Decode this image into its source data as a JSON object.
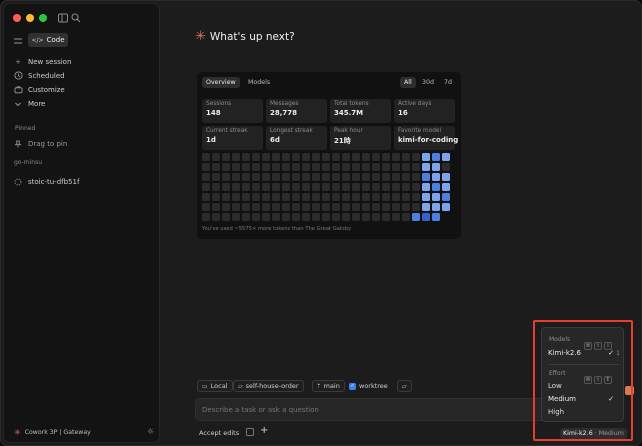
{
  "sidebar": {
    "mode_label": "Code",
    "actions": [
      {
        "label": "New session",
        "icon": "plus-icon"
      },
      {
        "label": "Scheduled",
        "icon": "clock-icon"
      },
      {
        "label": "Customize",
        "icon": "briefcase-icon"
      },
      {
        "label": "More",
        "icon": "chevron-down-icon"
      }
    ],
    "pinned_heading": "Pinned",
    "pinned_hint": "Drag to pin",
    "group_heading": "go-minsu",
    "session": "stoic-tu-dfb51f",
    "footer": "Cowork 3P | Gateway"
  },
  "greeting": "What's up next?",
  "stats_card": {
    "tabs": [
      "Overview",
      "Models"
    ],
    "ranges": [
      "All",
      "30d",
      "7d"
    ],
    "stats": [
      {
        "label": "Sessions",
        "value": "148"
      },
      {
        "label": "Messages",
        "value": "28,778"
      },
      {
        "label": "Total tokens",
        "value": "345.7M"
      },
      {
        "label": "Active days",
        "value": "16"
      },
      {
        "label": "Current streak",
        "value": "1d"
      },
      {
        "label": "Longest streak",
        "value": "6d"
      },
      {
        "label": "Peak hour",
        "value": "21時"
      },
      {
        "label": "Favorite model",
        "value": "kimi-for-coding"
      }
    ],
    "footnote": "You've used ~5575× more tokens than The Great Gatsby"
  },
  "chips": {
    "location": "Local",
    "branch_repo": "self-house-order",
    "branch": "main",
    "worktree": "worktree"
  },
  "input": {
    "placeholder": "Describe a task or ask a question"
  },
  "bottom": {
    "accept": "Accept edits",
    "model_pill": "Kimi-k2.6",
    "effort_pill": "Medium"
  },
  "popup": {
    "models_heading": "Models",
    "model_selected": "Kimi-k2.6",
    "effort_heading": "Effort",
    "efforts": [
      "Low",
      "Medium",
      "High"
    ],
    "effort_selected": "Medium"
  },
  "colors": {
    "accent": "#d97757",
    "heat_light": "#7ea4ec",
    "heat_mid": "#4d7fe0",
    "heat_dark": "#3560c7",
    "highlight": "#e3412c"
  }
}
